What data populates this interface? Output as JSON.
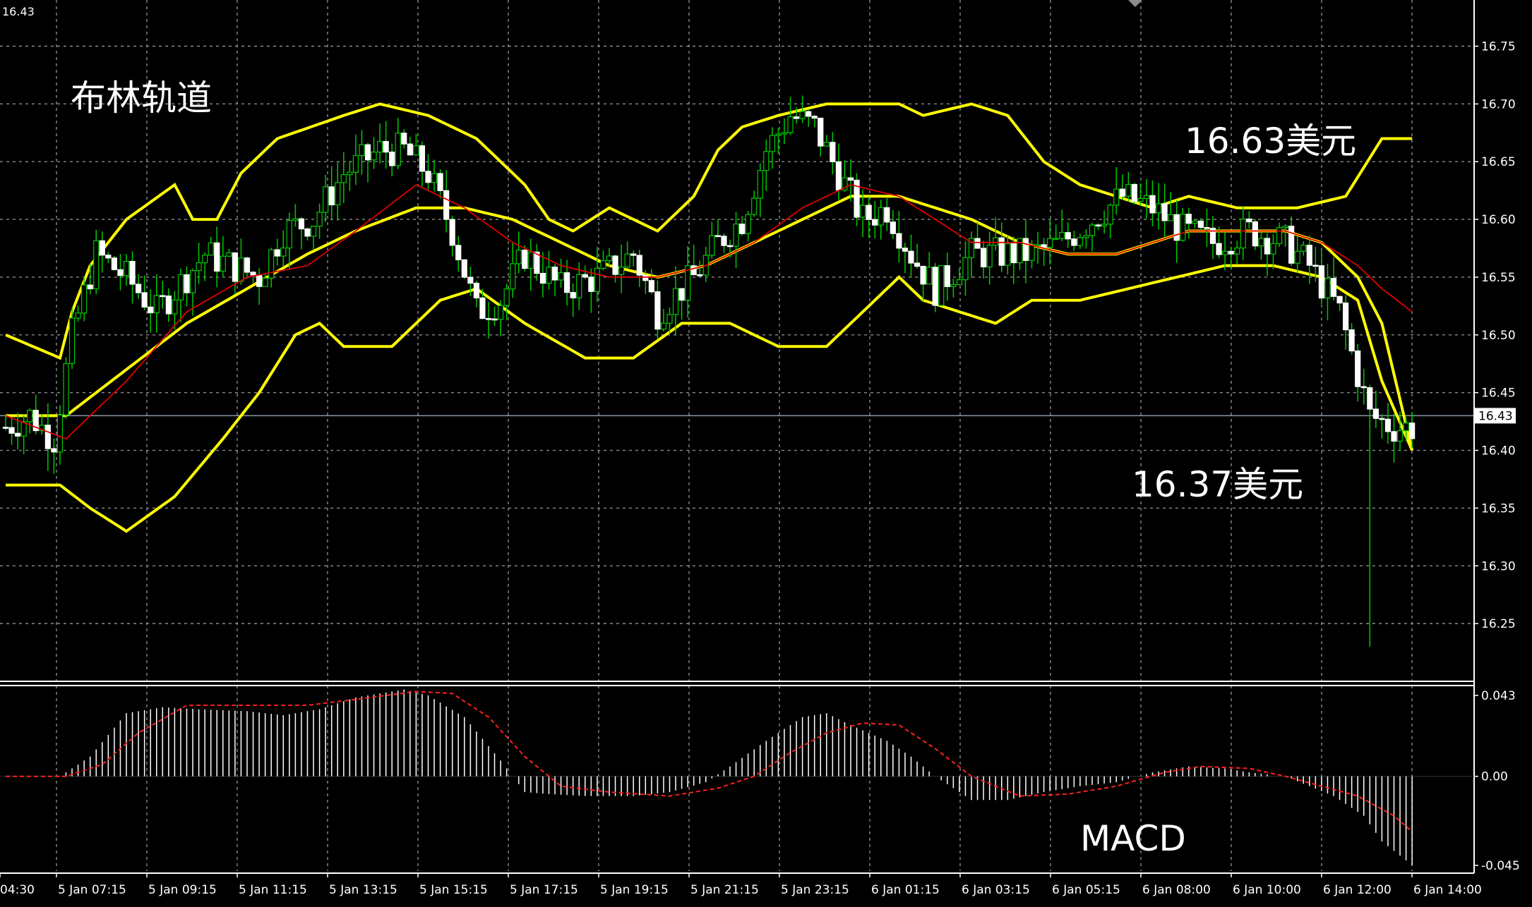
{
  "chart_data": [
    {
      "type": "candlestick",
      "title": "布林轨道",
      "colors": {
        "background": "#000000",
        "grid": "#8c8c8c",
        "candle_up": "#00c800",
        "candle_down": "#ffffff",
        "bands": "#ffff00",
        "middle_line": "#e00000",
        "current_price_line": "#8c9aa8"
      },
      "y_ticks": [
        "16.75",
        "16.70",
        "16.65",
        "16.60",
        "16.55",
        "16.50",
        "16.45",
        "16.40",
        "16.35",
        "16.30",
        "16.25"
      ],
      "ylim": [
        16.2,
        16.79
      ],
      "top_left_value": "16.43",
      "current_price": 16.43,
      "current_price_label": "16.43",
      "x_ticks": [
        "04:30",
        "5 Jan 07:15",
        "5 Jan 09:15",
        "5 Jan 11:15",
        "5 Jan 13:15",
        "5 Jan 15:15",
        "5 Jan 17:15",
        "5 Jan 19:15",
        "5 Jan 21:15",
        "5 Jan 23:15",
        "6 Jan 01:15",
        "6 Jan 03:15",
        "6 Jan 05:15",
        "6 Jan 08:00",
        "6 Jan 10:00",
        "6 Jan 12:00",
        "6 Jan 14:00"
      ],
      "annotations": [
        {
          "text": "16.63美元",
          "value": 16.63
        },
        {
          "text": "16.37美元",
          "value": 16.37
        }
      ],
      "candle_knots": [
        [
          0,
          16.42
        ],
        [
          4,
          16.43
        ],
        [
          8,
          16.41
        ],
        [
          11,
          16.5
        ],
        [
          15,
          16.57
        ],
        [
          20,
          16.55
        ],
        [
          25,
          16.52
        ],
        [
          33,
          16.57
        ],
        [
          42,
          16.55
        ],
        [
          46,
          16.59
        ],
        [
          51,
          16.6
        ],
        [
          56,
          16.64
        ],
        [
          62,
          16.66
        ],
        [
          66,
          16.66
        ],
        [
          70,
          16.64
        ],
        [
          74,
          16.59
        ],
        [
          78,
          16.52
        ],
        [
          82,
          16.53
        ],
        [
          86,
          16.57
        ],
        [
          92,
          16.54
        ],
        [
          98,
          16.55
        ],
        [
          104,
          16.57
        ],
        [
          108,
          16.52
        ],
        [
          114,
          16.55
        ],
        [
          118,
          16.58
        ],
        [
          122,
          16.6
        ],
        [
          126,
          16.66
        ],
        [
          130,
          16.69
        ],
        [
          134,
          16.68
        ],
        [
          138,
          16.64
        ],
        [
          142,
          16.6
        ],
        [
          146,
          16.61
        ],
        [
          150,
          16.57
        ],
        [
          154,
          16.54
        ],
        [
          160,
          16.57
        ],
        [
          165,
          16.57
        ],
        [
          170,
          16.57
        ],
        [
          175,
          16.58
        ],
        [
          180,
          16.6
        ],
        [
          185,
          16.62
        ],
        [
          190,
          16.61
        ],
        [
          195,
          16.59
        ],
        [
          200,
          16.58
        ],
        [
          206,
          16.59
        ],
        [
          212,
          16.58
        ],
        [
          216,
          16.56
        ],
        [
          221,
          16.52
        ],
        [
          226,
          16.43
        ],
        [
          230,
          16.42
        ],
        [
          233,
          16.42
        ]
      ],
      "bollinger": {
        "period": 20,
        "upper": [
          [
            0,
            16.5
          ],
          [
            9,
            16.48
          ],
          [
            11,
            16.52
          ],
          [
            14,
            16.56
          ],
          [
            20,
            16.6
          ],
          [
            28,
            16.63
          ],
          [
            31,
            16.6
          ],
          [
            35,
            16.6
          ],
          [
            39,
            16.64
          ],
          [
            45,
            16.67
          ],
          [
            56,
            16.69
          ],
          [
            62,
            16.7
          ],
          [
            70,
            16.69
          ],
          [
            78,
            16.67
          ],
          [
            86,
            16.63
          ],
          [
            90,
            16.6
          ],
          [
            94,
            16.59
          ],
          [
            100,
            16.61
          ],
          [
            108,
            16.59
          ],
          [
            114,
            16.62
          ],
          [
            118,
            16.66
          ],
          [
            122,
            16.68
          ],
          [
            128,
            16.69
          ],
          [
            136,
            16.7
          ],
          [
            148,
            16.7
          ],
          [
            152,
            16.69
          ],
          [
            160,
            16.7
          ],
          [
            166,
            16.69
          ],
          [
            172,
            16.65
          ],
          [
            178,
            16.63
          ],
          [
            184,
            16.62
          ],
          [
            190,
            16.61
          ],
          [
            196,
            16.62
          ],
          [
            204,
            16.61
          ],
          [
            214,
            16.61
          ],
          [
            222,
            16.62
          ],
          [
            228,
            16.67
          ],
          [
            233,
            16.67
          ]
        ],
        "middle": [
          [
            0,
            16.43
          ],
          [
            10,
            16.43
          ],
          [
            20,
            16.47
          ],
          [
            30,
            16.51
          ],
          [
            40,
            16.54
          ],
          [
            50,
            16.57
          ],
          [
            58,
            16.59
          ],
          [
            68,
            16.61
          ],
          [
            76,
            16.61
          ],
          [
            84,
            16.6
          ],
          [
            92,
            16.58
          ],
          [
            100,
            16.56
          ],
          [
            108,
            16.55
          ],
          [
            116,
            16.56
          ],
          [
            124,
            16.58
          ],
          [
            132,
            16.6
          ],
          [
            140,
            16.62
          ],
          [
            148,
            16.62
          ],
          [
            154,
            16.61
          ],
          [
            160,
            16.6
          ],
          [
            168,
            16.58
          ],
          [
            176,
            16.57
          ],
          [
            184,
            16.57
          ],
          [
            190,
            16.58
          ],
          [
            196,
            16.59
          ],
          [
            204,
            16.59
          ],
          [
            212,
            16.59
          ],
          [
            218,
            16.58
          ],
          [
            224,
            16.55
          ],
          [
            228,
            16.51
          ],
          [
            233,
            16.4
          ]
        ],
        "lower": [
          [
            0,
            16.37
          ],
          [
            9,
            16.37
          ],
          [
            14,
            16.35
          ],
          [
            20,
            16.33
          ],
          [
            28,
            16.36
          ],
          [
            36,
            16.41
          ],
          [
            42,
            16.45
          ],
          [
            48,
            16.5
          ],
          [
            52,
            16.51
          ],
          [
            56,
            16.49
          ],
          [
            64,
            16.49
          ],
          [
            72,
            16.53
          ],
          [
            78,
            16.54
          ],
          [
            86,
            16.51
          ],
          [
            96,
            16.48
          ],
          [
            104,
            16.48
          ],
          [
            112,
            16.51
          ],
          [
            120,
            16.51
          ],
          [
            128,
            16.49
          ],
          [
            136,
            16.49
          ],
          [
            142,
            16.52
          ],
          [
            148,
            16.55
          ],
          [
            152,
            16.53
          ],
          [
            158,
            16.52
          ],
          [
            164,
            16.51
          ],
          [
            170,
            16.53
          ],
          [
            178,
            16.53
          ],
          [
            186,
            16.54
          ],
          [
            194,
            16.55
          ],
          [
            202,
            16.56
          ],
          [
            210,
            16.56
          ],
          [
            218,
            16.55
          ],
          [
            224,
            16.53
          ],
          [
            228,
            16.46
          ],
          [
            233,
            16.4
          ]
        ]
      },
      "middle_line_red": [
        [
          0,
          16.43
        ],
        [
          10,
          16.41
        ],
        [
          20,
          16.46
        ],
        [
          30,
          16.52
        ],
        [
          40,
          16.55
        ],
        [
          50,
          16.56
        ],
        [
          58,
          16.59
        ],
        [
          68,
          16.63
        ],
        [
          76,
          16.61
        ],
        [
          84,
          16.58
        ],
        [
          92,
          16.56
        ],
        [
          100,
          16.55
        ],
        [
          108,
          16.55
        ],
        [
          116,
          16.56
        ],
        [
          124,
          16.58
        ],
        [
          132,
          16.61
        ],
        [
          140,
          16.63
        ],
        [
          148,
          16.62
        ],
        [
          154,
          16.6
        ],
        [
          160,
          16.58
        ],
        [
          168,
          16.58
        ],
        [
          176,
          16.57
        ],
        [
          184,
          16.57
        ],
        [
          190,
          16.58
        ],
        [
          196,
          16.59
        ],
        [
          204,
          16.59
        ],
        [
          212,
          16.59
        ],
        [
          218,
          16.58
        ],
        [
          224,
          16.56
        ],
        [
          228,
          16.54
        ],
        [
          233,
          16.52
        ]
      ]
    },
    {
      "type": "bar",
      "title": "MACD",
      "y_ticks": [
        "0.043",
        "0.00",
        "-0.045"
      ],
      "ylim": [
        -0.048,
        0.046
      ],
      "colors": {
        "histogram": "#ffffff",
        "signal": "#ff2020"
      },
      "histogram_knots": [
        [
          0,
          0.0
        ],
        [
          9,
          0.0
        ],
        [
          14,
          0.01
        ],
        [
          20,
          0.032
        ],
        [
          26,
          0.035
        ],
        [
          32,
          0.034
        ],
        [
          40,
          0.033
        ],
        [
          46,
          0.031
        ],
        [
          52,
          0.034
        ],
        [
          58,
          0.04
        ],
        [
          66,
          0.044
        ],
        [
          70,
          0.041
        ],
        [
          76,
          0.03
        ],
        [
          82,
          0.008
        ],
        [
          86,
          -0.008
        ],
        [
          90,
          -0.009
        ],
        [
          96,
          -0.01
        ],
        [
          104,
          -0.01
        ],
        [
          110,
          -0.008
        ],
        [
          116,
          -0.003
        ],
        [
          120,
          0.005
        ],
        [
          126,
          0.018
        ],
        [
          132,
          0.03
        ],
        [
          136,
          0.032
        ],
        [
          140,
          0.026
        ],
        [
          146,
          0.018
        ],
        [
          150,
          0.01
        ],
        [
          154,
          0.0
        ],
        [
          160,
          -0.012
        ],
        [
          166,
          -0.012
        ],
        [
          172,
          -0.008
        ],
        [
          178,
          -0.005
        ],
        [
          184,
          -0.003
        ],
        [
          190,
          0.002
        ],
        [
          196,
          0.005
        ],
        [
          202,
          0.004
        ],
        [
          206,
          0.002
        ],
        [
          212,
          0.0
        ],
        [
          216,
          -0.005
        ],
        [
          220,
          -0.01
        ],
        [
          225,
          -0.02
        ],
        [
          228,
          -0.033
        ],
        [
          233,
          -0.045
        ]
      ],
      "signal_knots": [
        [
          0,
          0.0
        ],
        [
          10,
          0.0
        ],
        [
          16,
          0.006
        ],
        [
          22,
          0.022
        ],
        [
          30,
          0.036
        ],
        [
          40,
          0.036
        ],
        [
          50,
          0.036
        ],
        [
          58,
          0.039
        ],
        [
          68,
          0.043
        ],
        [
          74,
          0.042
        ],
        [
          80,
          0.03
        ],
        [
          86,
          0.01
        ],
        [
          92,
          -0.005
        ],
        [
          100,
          -0.008
        ],
        [
          110,
          -0.01
        ],
        [
          118,
          -0.006
        ],
        [
          124,
          0.0
        ],
        [
          130,
          0.012
        ],
        [
          136,
          0.022
        ],
        [
          142,
          0.027
        ],
        [
          148,
          0.026
        ],
        [
          154,
          0.014
        ],
        [
          160,
          0.0
        ],
        [
          168,
          -0.01
        ],
        [
          176,
          -0.009
        ],
        [
          184,
          -0.005
        ],
        [
          192,
          0.002
        ],
        [
          198,
          0.005
        ],
        [
          206,
          0.004
        ],
        [
          212,
          0.0
        ],
        [
          218,
          -0.005
        ],
        [
          224,
          -0.01
        ],
        [
          230,
          -0.02
        ],
        [
          233,
          -0.028
        ]
      ]
    }
  ],
  "labels": {
    "macd": "MACD"
  }
}
